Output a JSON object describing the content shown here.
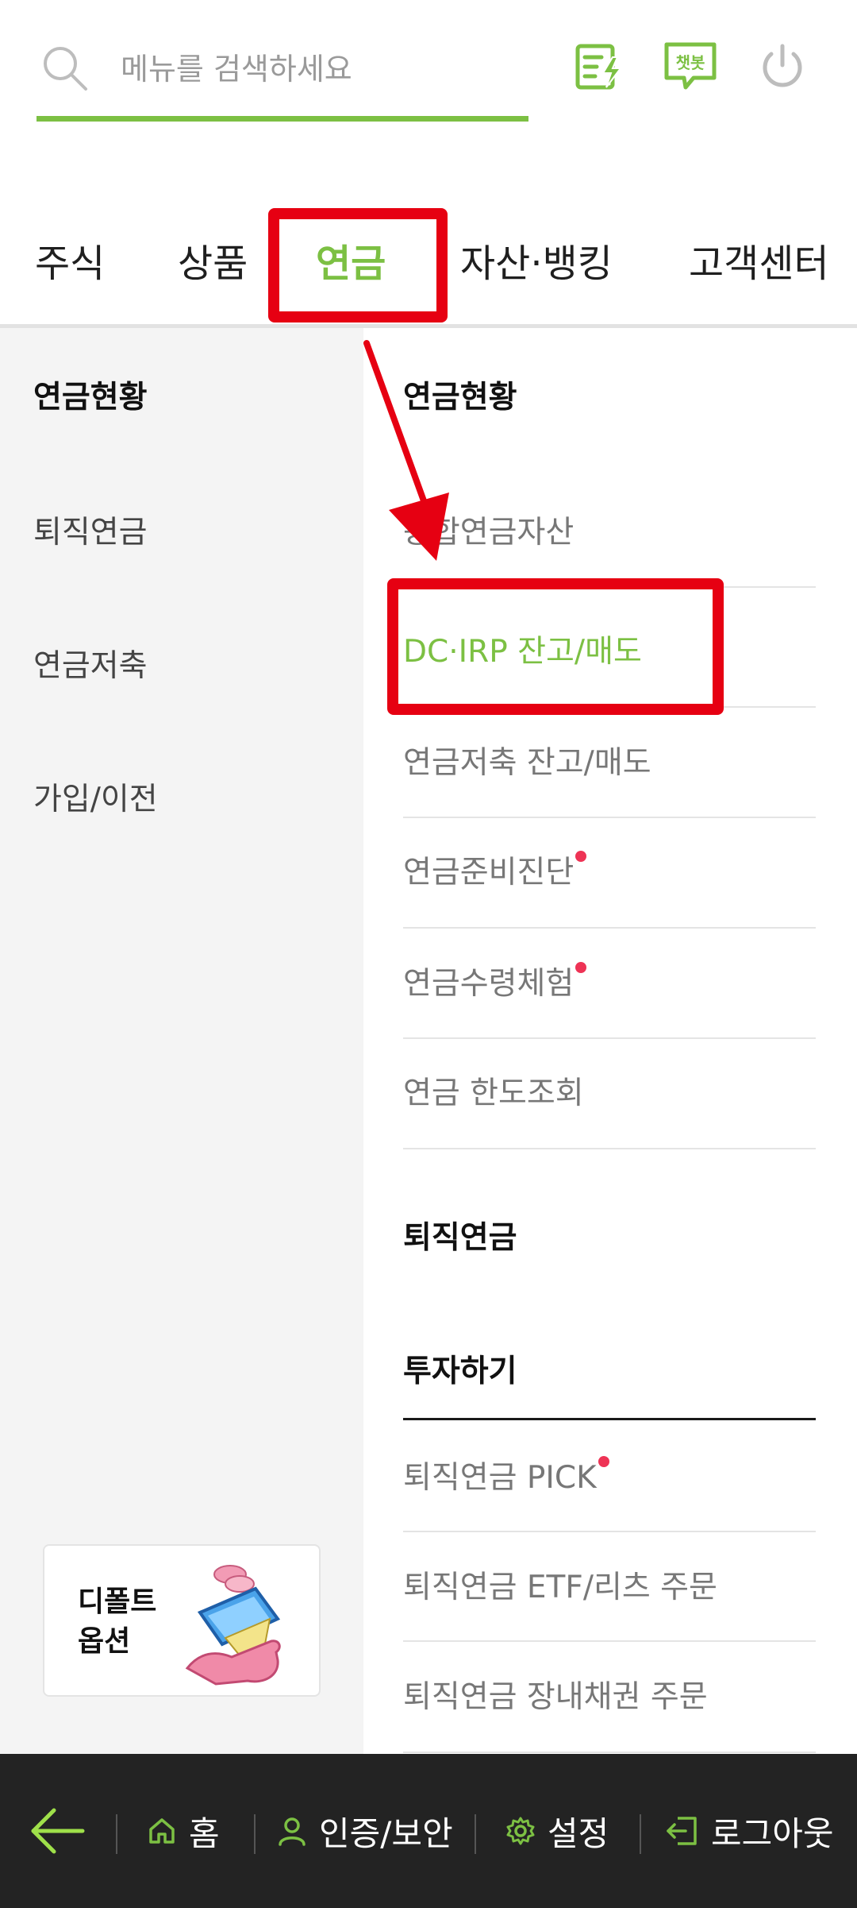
{
  "search": {
    "placeholder": "메뉴를 검색하세요"
  },
  "header_icons": {
    "quick_menu": "quick-menu-icon",
    "chatbot_label": "챗봇",
    "power": "power-icon"
  },
  "tabs": [
    {
      "label": "주식"
    },
    {
      "label": "상품"
    },
    {
      "label": "연금"
    },
    {
      "label": "자산·뱅킹"
    },
    {
      "label": "고객센터"
    }
  ],
  "left_menu": [
    {
      "label": "연금현황"
    },
    {
      "label": "퇴직연금"
    },
    {
      "label": "연금저축"
    },
    {
      "label": "가입/이전"
    }
  ],
  "promo": {
    "line1": "디폴트",
    "line2": "옵션"
  },
  "right_menu": {
    "section1_title": "연금현황",
    "items": [
      {
        "label": "종합연금자산"
      },
      {
        "label": "DC·IRP 잔고/매도"
      },
      {
        "label": "연금저축 잔고/매도"
      },
      {
        "label": "연금준비진단"
      },
      {
        "label": "연금수령체험"
      },
      {
        "label": "연금 한도조회"
      }
    ],
    "section2_title": "퇴직연금",
    "subsection_title": "투자하기",
    "items2": [
      {
        "label": "퇴직연금 PICK"
      },
      {
        "label": "퇴직연금 ETF/리츠 주문"
      },
      {
        "label": "퇴직연금 장내채권 주문"
      }
    ]
  },
  "bottom_bar": {
    "back": "back-arrow-icon",
    "home": "홈",
    "auth": "인증/보안",
    "settings": "설정",
    "logout": "로그아웃"
  },
  "colors": {
    "accent": "#7cc043",
    "annotation_red": "#e60012",
    "new_dot": "#ee3355",
    "bottom_bar": "#232323"
  }
}
